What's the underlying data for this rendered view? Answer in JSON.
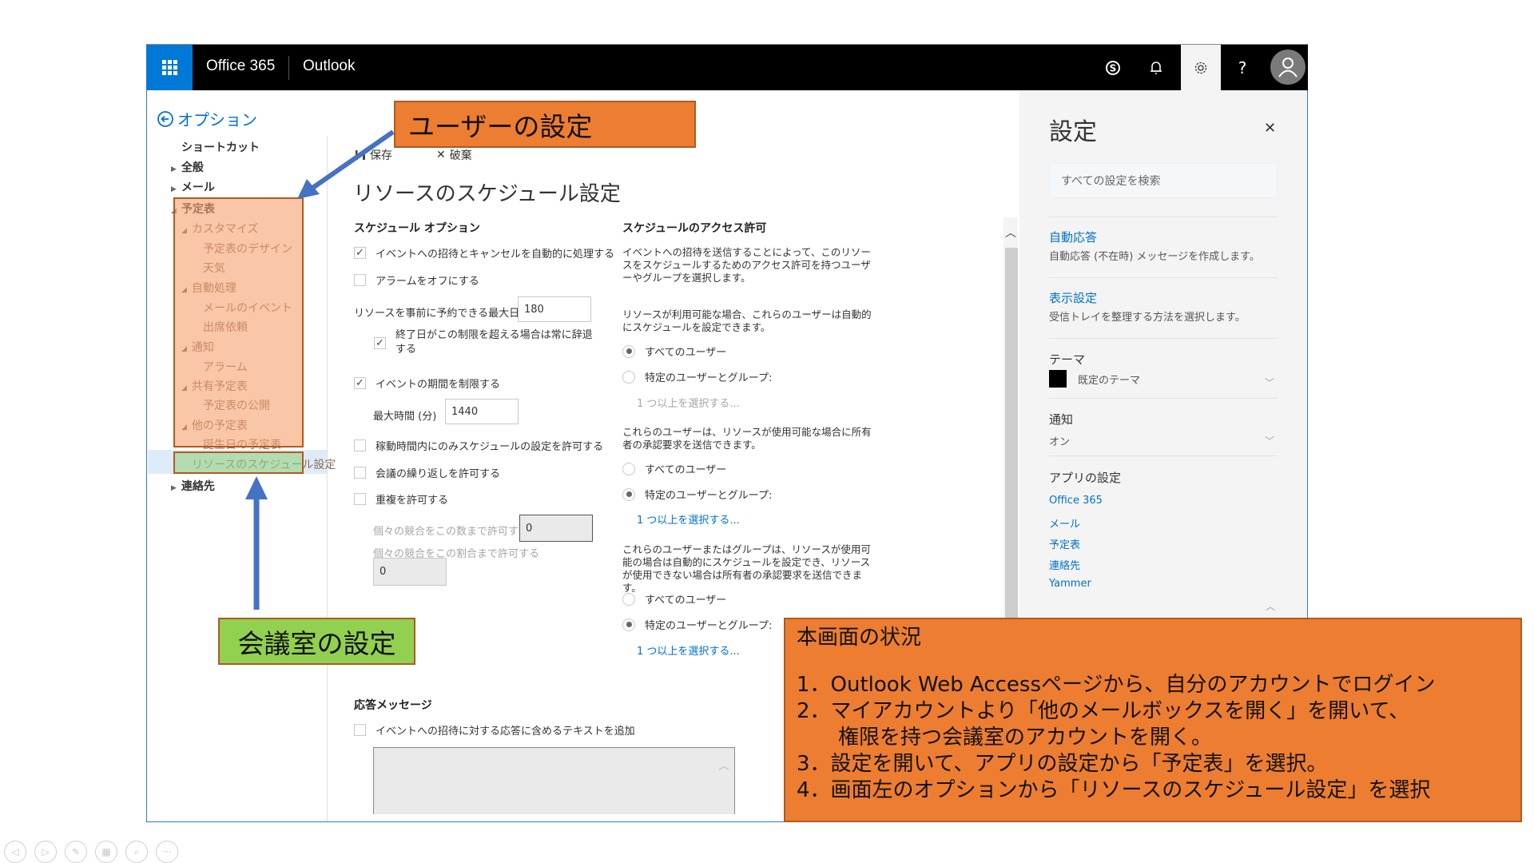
{
  "header": {
    "app_suite": "Office 365",
    "app_name": "Outlook",
    "icons": [
      "waffle-icon",
      "skype-icon",
      "bell-icon",
      "gear-icon",
      "help-icon",
      "avatar-icon"
    ],
    "help_glyph": "?"
  },
  "nav": {
    "back_label": "オプション",
    "items": [
      {
        "label": "ショートカット"
      },
      {
        "label": "全般"
      },
      {
        "label": "メール"
      },
      {
        "label": "予定表"
      },
      {
        "label": "カスタマイズ"
      },
      {
        "label": "予定表のデザイン"
      },
      {
        "label": "天気"
      },
      {
        "label": "自動処理"
      },
      {
        "label": "メールのイベント"
      },
      {
        "label": "出席依頼"
      },
      {
        "label": "通知"
      },
      {
        "label": "アラーム"
      },
      {
        "label": "共有予定表"
      },
      {
        "label": "予定表の公開"
      },
      {
        "label": "他の予定表"
      },
      {
        "label": "誕生日の予定表"
      },
      {
        "label": "リソースのスケジュール設定"
      },
      {
        "label": "連絡先"
      }
    ],
    "selected": "リソースのスケジュール設定"
  },
  "toolbar": {
    "save_label": "保存",
    "discard_label": "破棄"
  },
  "page": {
    "title": "リソースのスケジュール設定",
    "schedule_options": {
      "heading": "スケジュール オプション",
      "auto_process": {
        "label": "イベントへの招待とキャンセルを自動的に処理する",
        "checked": true
      },
      "turn_off_alarm": {
        "label": "アラームをオフにする",
        "checked": false
      },
      "max_days_label": "リソースを事前に予約できる最大日数",
      "max_days_value": "180",
      "decline_beyond": {
        "label": "終了日がこの制限を超える場合は常に辞退する",
        "checked": true
      },
      "limit_duration": {
        "label": "イベントの期間を制限する",
        "checked": true
      },
      "max_minutes_label": "最大時間 (分)",
      "max_minutes_value": "1440",
      "working_hours_only": {
        "label": "稼動時間内にのみスケジュールの設定を許可する",
        "checked": false
      },
      "allow_recurring": {
        "label": "会議の繰り返しを許可する",
        "checked": false
      },
      "allow_conflicts": {
        "label": "重複を許可する",
        "checked": false
      },
      "conflict_count_label": "個々の競合をこの数まで許可する",
      "conflict_count_value": "0",
      "conflict_percent_label": "個々の競合をこの割合まで許可する",
      "conflict_percent_value": "0"
    },
    "access": {
      "heading": "スケジュールのアクセス許可",
      "intro": "イベントへの招待を送信することによって、このリソースをスケジュールするためのアクセス許可を持つユーザーやグループを選択します。",
      "group1": {
        "desc": "リソースが利用可能な場合、これらのユーザーは自動的にスケジュールを設定できます。",
        "opt_all": "すべてのユーザー",
        "opt_specific": "特定のユーザーとグループ:",
        "selected": "all",
        "select_link": "1 つ以上を選択する..."
      },
      "group2": {
        "desc": "これらのユーザーは、リソースが使用可能な場合に所有者の承認要求を送信できます。",
        "opt_all": "すべてのユーザー",
        "opt_specific": "特定のユーザーとグループ:",
        "selected": "specific",
        "select_link": "1 つ以上を選択する..."
      },
      "group3": {
        "desc": "これらのユーザーまたはグループは、リソースが使用可能の場合は自動的にスケジュールを設定でき、リソースが使用できない場合は所有者の承認要求を送信できます。",
        "opt_all": "すべてのユーザー",
        "opt_specific": "特定のユーザーとグループ:",
        "selected": "specific",
        "select_link": "1 つ以上を選択する..."
      }
    },
    "reply": {
      "heading": "応答メッセージ",
      "add_text": {
        "label": "イベントへの招待に対する応答に含めるテキストを追加",
        "checked": false
      },
      "text_value": ""
    }
  },
  "settings_panel": {
    "title": "設定",
    "search_placeholder": "すべての設定を検索",
    "auto_reply_title": "自動応答",
    "auto_reply_desc": "自動応答 (不在時) メッセージを作成します。",
    "display_title": "表示設定",
    "display_desc": "受信トレイを整理する方法を選択します。",
    "theme_heading": "テーマ",
    "theme_value": "既定のテーマ",
    "theme_color": "#000000",
    "notify_heading": "通知",
    "notify_value": "オン",
    "app_settings_heading": "アプリの設定",
    "app_links": [
      "Office 365",
      "メール",
      "予定表",
      "連絡先",
      "Yammer"
    ]
  },
  "annotations": {
    "user_settings": "ユーザーの設定",
    "room_settings": "会議室の設定",
    "status_title": "本画面の状況",
    "steps": [
      "1．Outlook Web Accessページから、自分のアカウントでログイン",
      "2．マイアカウントより「他のメールボックスを開く」を開いて、",
      "　　権限を持つ会議室のアカウントを開く。",
      "3．設定を開いて、アプリの設定から「予定表」を選択。",
      "4．画面左のオプションから「リソースのスケジュール設定」を選択"
    ],
    "colors": {
      "orange": "#ed7d31",
      "green": "#92d050",
      "arrow": "#4472c4"
    }
  },
  "slide_controls": [
    "previous-icon",
    "next-icon",
    "pen-icon",
    "slides-icon",
    "zoom-icon",
    "more-icon"
  ]
}
